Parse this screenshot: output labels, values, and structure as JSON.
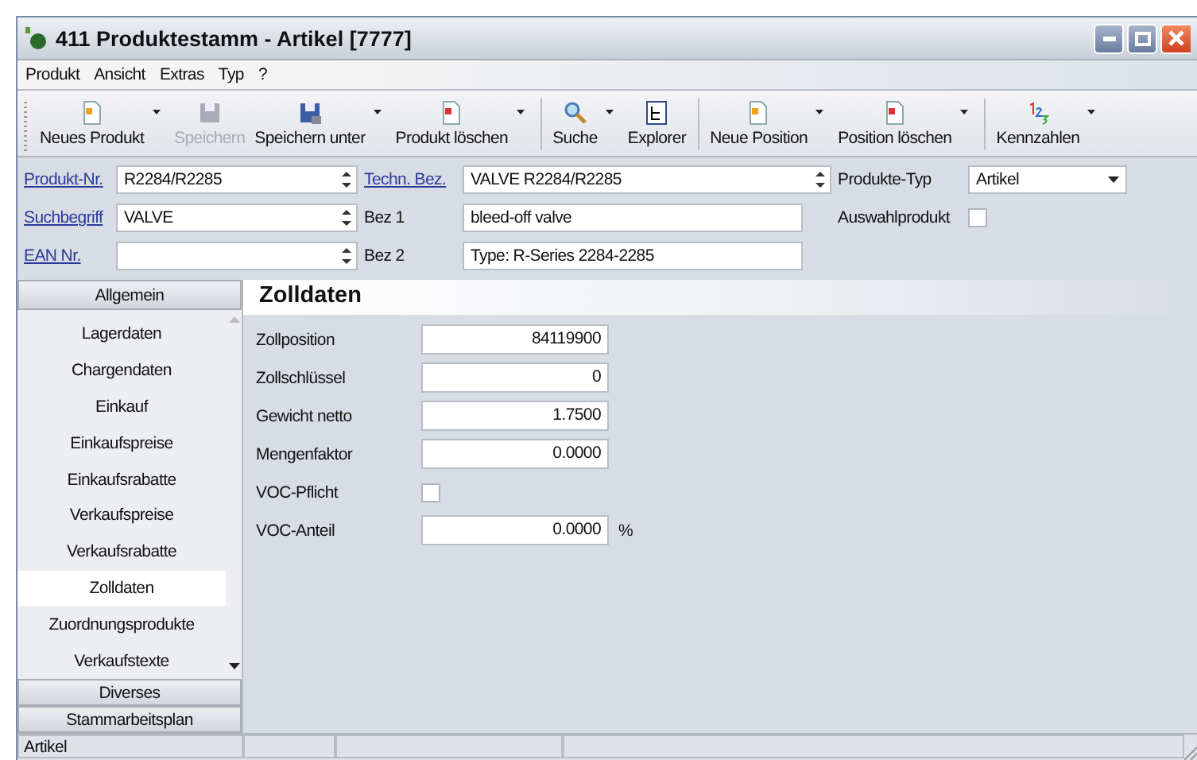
{
  "window": {
    "title": "411 Produktestamm - Artikel [7777]"
  },
  "menu": [
    "Produkt",
    "Ansicht",
    "Extras",
    "Typ",
    "?"
  ],
  "toolbar": [
    [
      {
        "label": "Neues Produkt",
        "disabled": false,
        "dropdown": true
      },
      {
        "label": "Speichern",
        "disabled": true,
        "dropdown": false
      },
      {
        "label": "Speichern unter",
        "disabled": false,
        "dropdown": true
      },
      {
        "label": "Produkt löschen",
        "disabled": false,
        "dropdown": true
      }
    ],
    [
      {
        "label": "Suche",
        "disabled": false,
        "dropdown": true
      },
      {
        "label": "Explorer",
        "disabled": false,
        "dropdown": false
      }
    ],
    [
      {
        "label": "Neue Position",
        "disabled": false,
        "dropdown": true
      },
      {
        "label": "Position löschen",
        "disabled": false,
        "dropdown": true
      }
    ],
    [
      {
        "label": "Kennzahlen",
        "disabled": false,
        "dropdown": true
      }
    ]
  ],
  "header": {
    "produkt_nr": {
      "label": "Produkt-Nr.",
      "value": "R2284/R2285"
    },
    "suchbegriff": {
      "label": "Suchbegriff",
      "value": "VALVE"
    },
    "ean_nr": {
      "label": "EAN Nr."
    },
    "techn_bez": {
      "label": "Techn. Bez.",
      "value": "VALVE R2284/R2285"
    },
    "bez1": {
      "label": "Bez 1",
      "value": "bleed-off valve"
    },
    "bez2": {
      "label": "Bez 2",
      "value": "Type: R-Series 2284-2285"
    },
    "produkte_typ": {
      "label": "Produkte-Typ",
      "value": "Artikel"
    },
    "auswahlprodukt": {
      "label": "Auswahlprodukt",
      "checked": false
    }
  },
  "nav": {
    "top": "Allgemein",
    "items": [
      {
        "label": "Lagerdaten",
        "selected": false
      },
      {
        "label": "Chargendaten",
        "selected": false
      },
      {
        "label": "Einkauf",
        "selected": false
      },
      {
        "label": "Einkaufspreise",
        "selected": false
      },
      {
        "label": "Einkaufsrabatte",
        "selected": false
      },
      {
        "label": "Verkaufspreise",
        "selected": false
      },
      {
        "label": "Verkaufsrabatte",
        "selected": false
      },
      {
        "label": "Zolldaten",
        "selected": true
      },
      {
        "label": "Zuordnungsprodukte",
        "selected": false
      },
      {
        "label": "Verkaufstexte",
        "selected": false
      }
    ],
    "bottom": [
      "Diverses",
      "Stammarbeitsplan"
    ]
  },
  "content": {
    "title": "Zolldaten",
    "rows": [
      {
        "kind": "input",
        "label": "Zollposition",
        "value": "84119900"
      },
      {
        "kind": "input",
        "label": "Zollschlüssel",
        "value": "0"
      },
      {
        "kind": "input",
        "label": "Gewicht netto",
        "value": "1.7500"
      },
      {
        "kind": "input",
        "label": "Mengenfaktor",
        "value": "0.0000"
      },
      {
        "kind": "checkbox",
        "label": "VOC-Pflicht",
        "checked": false
      },
      {
        "kind": "input",
        "label": "VOC-Anteil",
        "value": "0.0000",
        "unit": "%"
      }
    ]
  },
  "status_bar": [
    "Artikel"
  ]
}
